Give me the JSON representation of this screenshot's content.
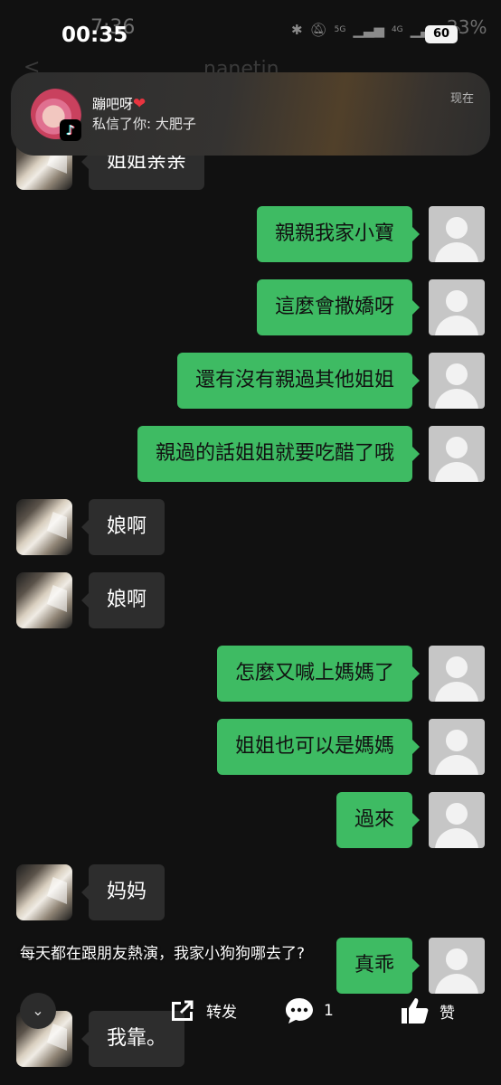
{
  "status_bar": {
    "ghost_time": "7:36",
    "time": "00:35",
    "icons": [
      "bluetooth-icon",
      "mute-bell-icon",
      "5g-signal-icon",
      "4g-signal-icon",
      "wifi-icon"
    ],
    "net_5g": "5G",
    "net_4g": "4G",
    "battery": "60",
    "ghost_battery": "23%"
  },
  "header_ghost": {
    "back": "<",
    "name": "nanetin"
  },
  "notification": {
    "title": "蹦吧呀",
    "heart": "❤",
    "body": "私信了你: 大肥子",
    "time": "现在",
    "app_icon": "tiktok-icon"
  },
  "messages": [
    {
      "side": "in",
      "text": "姐姐亲亲"
    },
    {
      "side": "out",
      "text": "親親我家小寶"
    },
    {
      "side": "out",
      "text": "這麼會撒嬌呀"
    },
    {
      "side": "out",
      "text": "還有沒有親過其他姐姐"
    },
    {
      "side": "out",
      "text": "親過的話姐姐就要吃醋了哦"
    },
    {
      "side": "in",
      "text": "娘啊"
    },
    {
      "side": "in",
      "text": "娘啊"
    },
    {
      "side": "out",
      "text": "怎麼又喊上媽媽了"
    },
    {
      "side": "out",
      "text": "姐姐也可以是媽媽"
    },
    {
      "side": "out",
      "text": "過來"
    },
    {
      "side": "in",
      "text": "妈妈"
    },
    {
      "side": "out",
      "text": "真乖"
    },
    {
      "side": "in",
      "text": "我靠。"
    }
  ],
  "caption": "每天都在跟朋友熱演，我家小狗狗哪去了?",
  "actions": {
    "collapse_icon": "chevron-down-icon",
    "share_label": "转发",
    "comment_count": "1",
    "like_label": "赞"
  },
  "colors": {
    "incoming_bubble": "#2d2d2d",
    "outgoing_bubble": "#3ebb63",
    "background": "#111111"
  }
}
